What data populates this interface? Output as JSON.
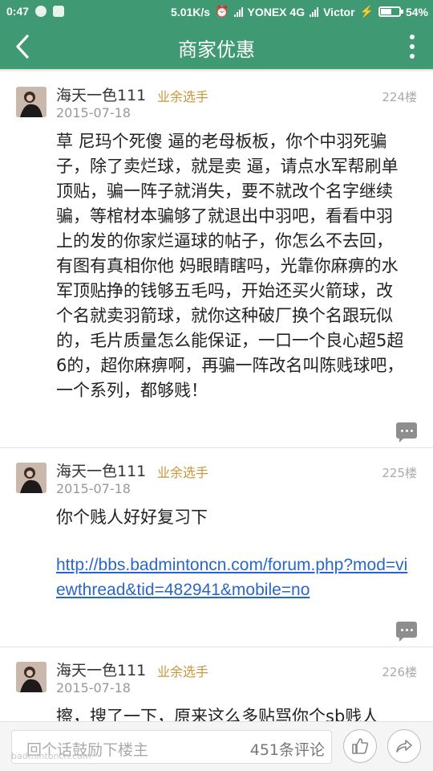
{
  "status_bar": {
    "time": "0:47",
    "net_speed": "5.01K/s",
    "carrier1": "YONEX 4G",
    "carrier2": "Victor",
    "battery_text": "54%",
    "battery_level": 0.54
  },
  "nav": {
    "title": "商家优惠",
    "back_icon": "back-arrow-icon",
    "more_icon": "more-vertical-icon"
  },
  "posts": [
    {
      "author": "海天一色111",
      "badge": "业余选手",
      "date": "2015-07-18",
      "floor": "224楼",
      "content": "草 尼玛个死傻 逼的老母板板，你个中羽死骗子，除了卖烂球，就是卖 逼，请点水军帮刷单顶贴，骗一阵子就消失，要不就改个名字继续骗，等棺材本骗够了就退出中羽吧，看看中羽上的发的你家烂逼球的帖子，你怎么不去回，有图有真相你他 妈眼睛瞎吗，光靠你麻痹的水军顶贴挣的钱够五毛吗，开始还买火箭球，改个名就卖羽箭球，就你这种破厂换个名跟玩似的，毛片质量怎么能保证，一口一个良心超5超6的，超你麻痹啊，再骗一阵改名叫陈贱球吧，一个系列，都够贱！"
    },
    {
      "author": "海天一色111",
      "badge": "业余选手",
      "date": "2015-07-18",
      "floor": "225楼",
      "content": "你个贱人好好复习下",
      "link": "http://bbs.badmintoncn.com/forum.php?mod=viewthread&tid=482941&mobile=no"
    },
    {
      "author": "海天一色111",
      "badge": "业余选手",
      "date": "2015-07-18",
      "floor": "226楼",
      "content": "擦，搜了一下，原来这么多贴骂你个sb贱人"
    }
  ],
  "bottom_bar": {
    "comment_placeholder": "回个话鼓励下楼主",
    "comment_count": "451条评论",
    "watermark": "badmintoncn.com",
    "like_icon": "thumbs-up-icon",
    "share_icon": "share-icon"
  },
  "colors": {
    "header": "#3f9a73",
    "badge": "#c9963a",
    "link": "#2a67c5"
  }
}
